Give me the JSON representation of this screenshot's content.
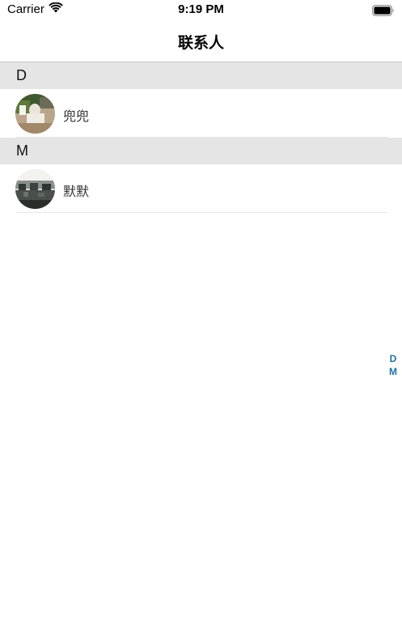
{
  "status_bar": {
    "carrier": "Carrier",
    "time": "9:19 PM",
    "wifi_icon": "wifi-icon",
    "battery_icon": "battery-icon"
  },
  "nav": {
    "title": "联系人"
  },
  "sections": [
    {
      "letter": "D",
      "contacts": [
        {
          "name": "兜兜",
          "avatar": "photo-avatar-green"
        }
      ]
    },
    {
      "letter": "M",
      "contacts": [
        {
          "name": "默默",
          "avatar": "photo-avatar-office"
        }
      ]
    }
  ],
  "index": [
    "D",
    "M"
  ],
  "colors": {
    "section_bg": "#e5e5e5",
    "index_color": "#1e6fa8"
  }
}
